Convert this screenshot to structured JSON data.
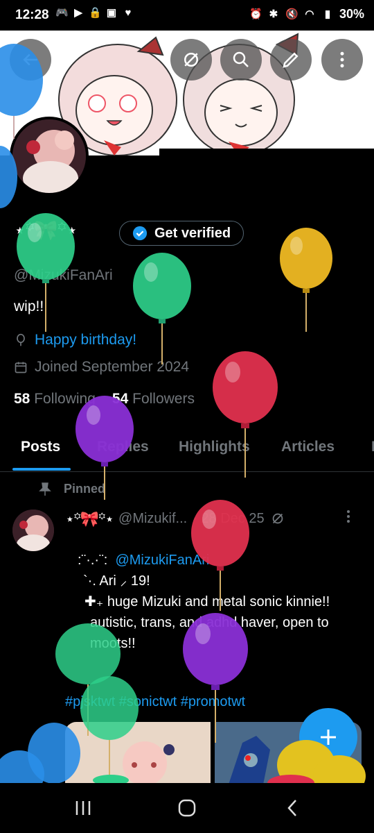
{
  "status_bar": {
    "time": "12:28",
    "battery": "30%"
  },
  "profile": {
    "display_name": "⋆꙳🎀꙳⋆",
    "verify_label": "Get verified",
    "handle": "@MizukiFanAri",
    "bio": "wip!!",
    "birthday": "Happy birthday!",
    "joined": "Joined September 2024",
    "following_count": "58",
    "following_label": "Following",
    "followers_count": "54",
    "followers_label": "Followers"
  },
  "tabs": [
    "Posts",
    "Replies",
    "Highlights",
    "Articles",
    "M"
  ],
  "post": {
    "pinned_label": "Pinned",
    "author_name": "⋆꙳🎀꙳⋆",
    "author_handle": "@Mizukif...",
    "date": "· 28 Dec 25",
    "line1_prefix": ":¨·.·¨:",
    "line1_mention": "@MizukiFanAri",
    "line2": "`·. Ari ⸝ 19!",
    "line3": "✚₊ huge Mizuki and metal sonic kinnie!!",
    "line4": "autistic, trans, and adhd haver, open to moots!!",
    "hashtags": "#pjsktwt #sonictwt #promotwt"
  },
  "colors": {
    "accent": "#1d9bf0",
    "muted": "#71767b",
    "balloon_green": "#2ecf8a",
    "balloon_gold": "#e3b021",
    "balloon_red": "#e0304e",
    "balloon_purple": "#8a2fd6",
    "balloon_blue": "#2a8ee8"
  }
}
